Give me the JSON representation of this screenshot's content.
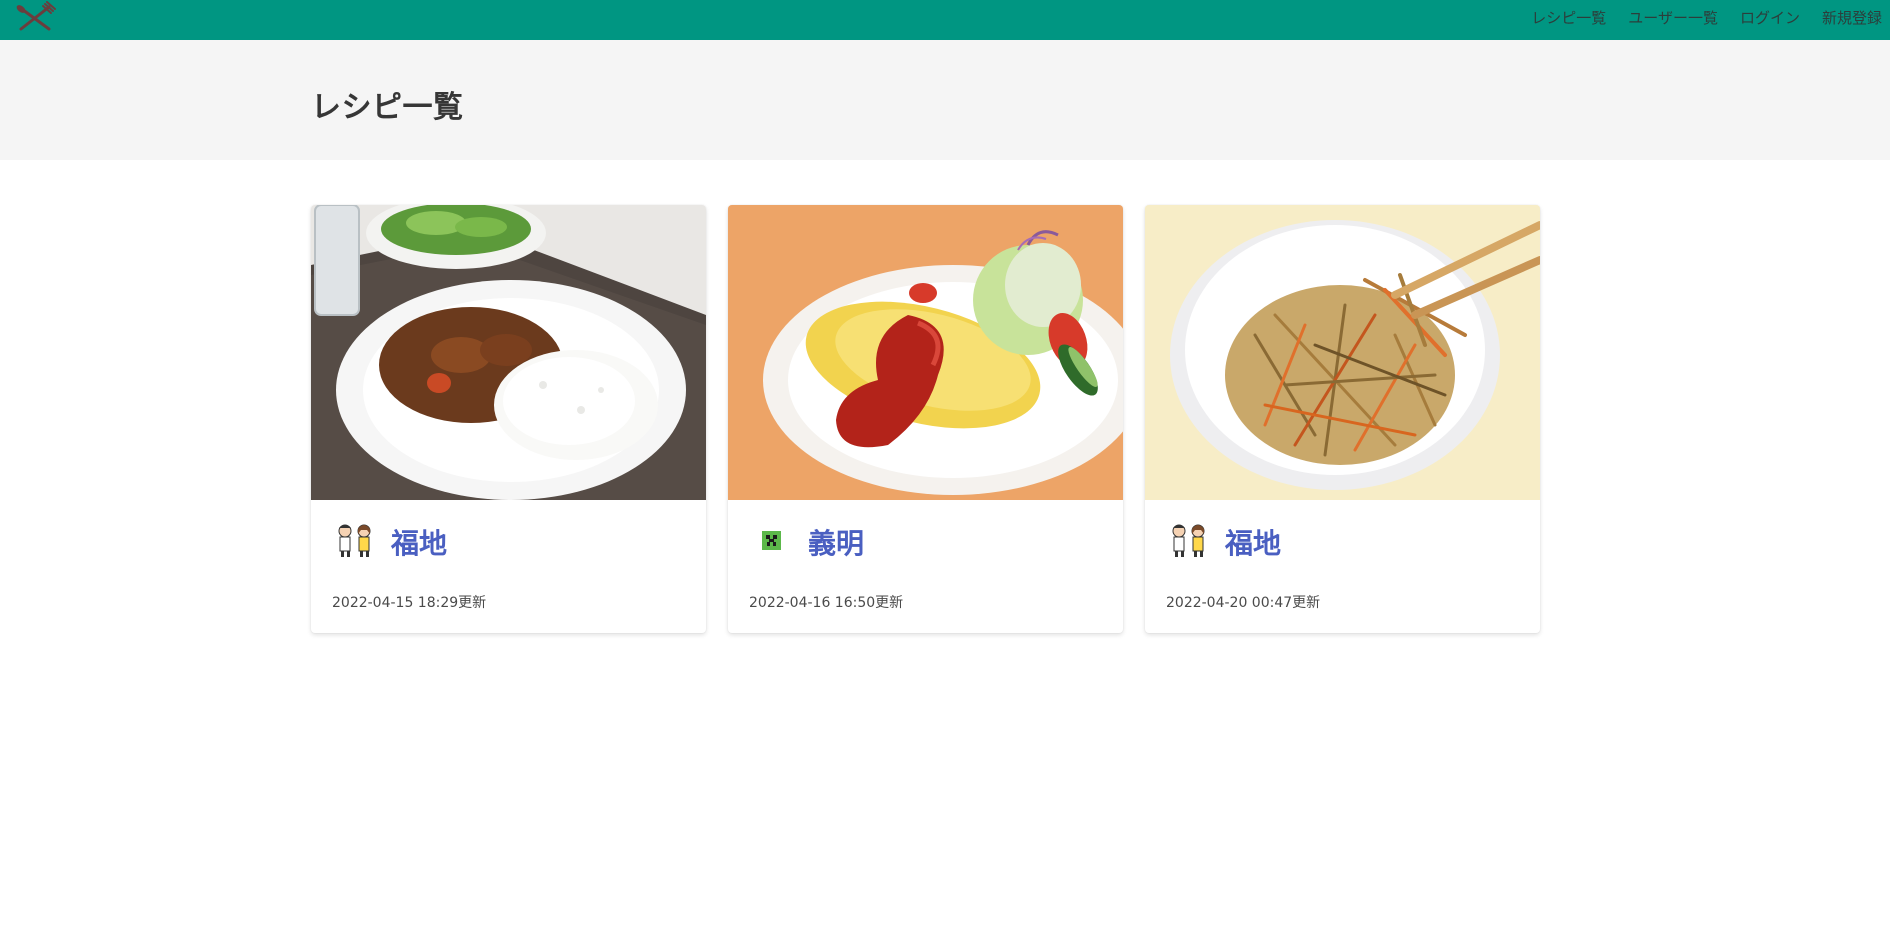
{
  "navbar": {
    "background": "#009682",
    "logo_icon": "fork-knife-icon",
    "links": [
      {
        "label": "レシピ一覧"
      },
      {
        "label": "ユーザー一覧"
      },
      {
        "label": "ログイン"
      },
      {
        "label": "新規登録"
      }
    ]
  },
  "page": {
    "title": "レシピ一覧"
  },
  "recipes": [
    {
      "image": "curry-rice-photo",
      "avatar": "chef-duo-avatar",
      "author": "福地",
      "updated": "2022-04-15 18:29更新"
    },
    {
      "image": "omurice-photo",
      "avatar": "creeper-avatar",
      "author": "義明",
      "updated": "2022-04-16 16:50更新"
    },
    {
      "image": "kinpira-gobo-photo",
      "avatar": "chef-duo-avatar",
      "author": "福地",
      "updated": "2022-04-20 00:47更新"
    }
  ],
  "colors": {
    "accent": "#009682",
    "link": "#4a5fc1",
    "hero": "#f5f5f5"
  }
}
